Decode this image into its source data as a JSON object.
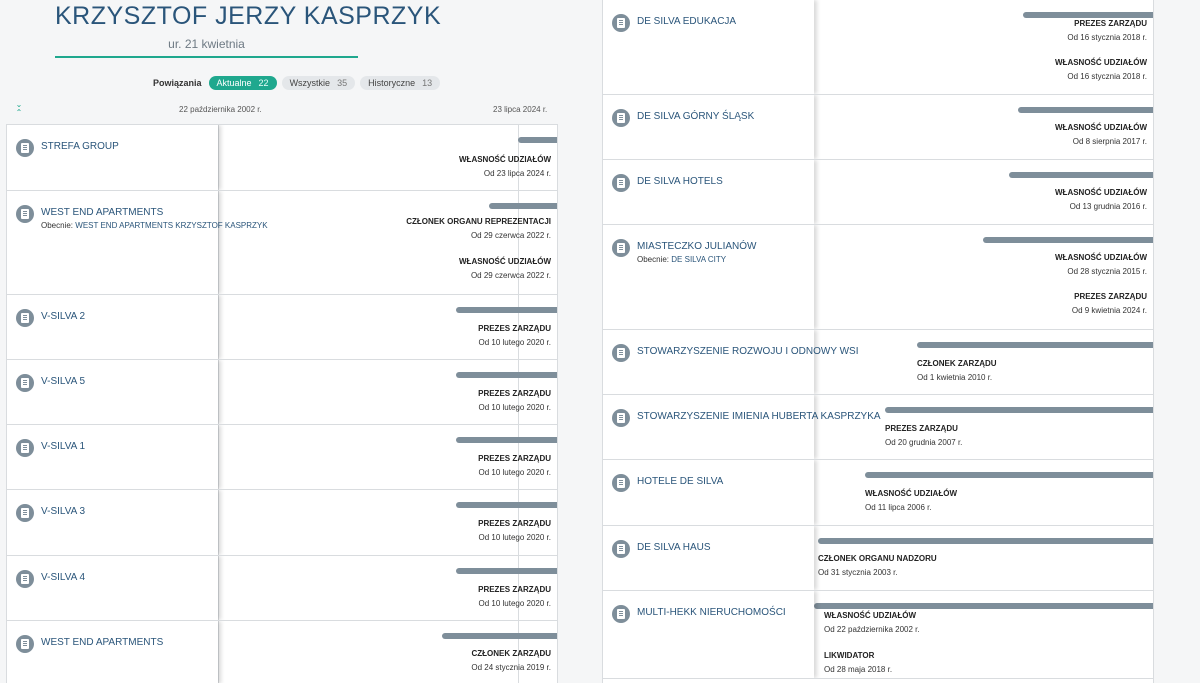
{
  "person": {
    "name": "KRZYSZTOF JERZY KASPRZYK",
    "dob": "ur. 21 kwietnia"
  },
  "filters": {
    "label": "Powiązania",
    "tabs": [
      {
        "label": "Aktualne",
        "count": "22"
      },
      {
        "label": "Wszystkie",
        "count": "35"
      },
      {
        "label": "Historyczne",
        "count": "13"
      }
    ]
  },
  "axis": {
    "start": "22 października 2002 r.",
    "end": "23 lipca 2024 r."
  },
  "colors": {
    "accent": "#1fa88e",
    "link": "#2a557a",
    "bar": "#7e8e9a"
  },
  "left_rows": [
    {
      "name": "STREFA GROUP",
      "rels": [
        {
          "title": "WŁASNOŚĆ UDZIAŁÓW",
          "date": "Od 23 lipca 2024 r."
        }
      ]
    },
    {
      "name": "WEST END APARTMENTS",
      "sub_prefix": "Obecnie:",
      "sub_value": "WEST END APARTMENTS KRZYSZTOF KASPRZYK",
      "rels": [
        {
          "title": "CZŁONEK ORGANU REPREZENTACJI",
          "date": "Od 29 czerwca 2022 r."
        },
        {
          "title": "WŁASNOŚĆ UDZIAŁÓW",
          "date": "Od 29 czerwca 2022 r."
        }
      ]
    },
    {
      "name": "V-SILVA 2",
      "rels": [
        {
          "title": "PREZES ZARZĄDU",
          "date": "Od 10 lutego 2020 r."
        }
      ]
    },
    {
      "name": "V-SILVA 5",
      "rels": [
        {
          "title": "PREZES ZARZĄDU",
          "date": "Od 10 lutego 2020 r."
        }
      ]
    },
    {
      "name": "V-SILVA 1",
      "rels": [
        {
          "title": "PREZES ZARZĄDU",
          "date": "Od 10 lutego 2020 r."
        }
      ]
    },
    {
      "name": "V-SILVA 3",
      "rels": [
        {
          "title": "PREZES ZARZĄDU",
          "date": "Od 10 lutego 2020 r."
        }
      ]
    },
    {
      "name": "V-SILVA 4",
      "rels": [
        {
          "title": "PREZES ZARZĄDU",
          "date": "Od 10 lutego 2020 r."
        }
      ]
    },
    {
      "name": "WEST END APARTMENTS",
      "rels": [
        {
          "title": "CZŁONEK ZARZĄDU",
          "date": "Od 24 stycznia 2019 r."
        }
      ]
    }
  ],
  "right_rows": [
    {
      "name": "DE SILVA EDUKACJA",
      "rels": [
        {
          "title": "PREZES ZARZĄDU",
          "date": "Od 16 stycznia 2018 r."
        },
        {
          "title": "WŁASNOŚĆ UDZIAŁÓW",
          "date": "Od 16 stycznia 2018 r."
        }
      ]
    },
    {
      "name": "DE SILVA GÓRNY ŚLĄSK",
      "rels": [
        {
          "title": "WŁASNOŚĆ UDZIAŁÓW",
          "date": "Od 8 sierpnia 2017 r."
        }
      ]
    },
    {
      "name": "DE SILVA HOTELS",
      "rels": [
        {
          "title": "WŁASNOŚĆ UDZIAŁÓW",
          "date": "Od 13 grudnia 2016 r."
        }
      ]
    },
    {
      "name": "MIASTECZKO JULIANÓW",
      "sub_prefix": "Obecnie:",
      "sub_value": "DE SILVA CITY",
      "rels": [
        {
          "title": "WŁASNOŚĆ UDZIAŁÓW",
          "date": "Od 28 stycznia 2015 r."
        },
        {
          "title": "PREZES ZARZĄDU",
          "date": "Od 9 kwietnia 2024 r."
        }
      ]
    },
    {
      "name": "STOWARZYSZENIE ROZWOJU I ODNOWY WSI",
      "rels": [
        {
          "title": "CZŁONEK ZARZĄDU",
          "date": "Od 1 kwietnia 2010 r."
        }
      ]
    },
    {
      "name": "STOWARZYSZENIE IMIENIA HUBERTA KASPRZYKA",
      "rels": [
        {
          "title": "PREZES ZARZĄDU",
          "date": "Od 20 grudnia 2007 r."
        }
      ]
    },
    {
      "name": "HOTELE DE SILVA",
      "rels": [
        {
          "title": "WŁASNOŚĆ UDZIAŁÓW",
          "date": "Od 11 lipca 2006 r."
        }
      ]
    },
    {
      "name": "DE SILVA HAUS",
      "rels": [
        {
          "title": "CZŁONEK ORGANU NADZORU",
          "date": "Od 31 stycznia 2003 r."
        }
      ]
    },
    {
      "name": "MULTI-HEKK NIERUCHOMOŚCI",
      "rels": [
        {
          "title": "WŁASNOŚĆ UDZIAŁÓW",
          "date": "Od 22 października 2002 r."
        },
        {
          "title": "LIKWIDATOR",
          "date": "Od 28 maja 2018 r."
        }
      ]
    }
  ]
}
